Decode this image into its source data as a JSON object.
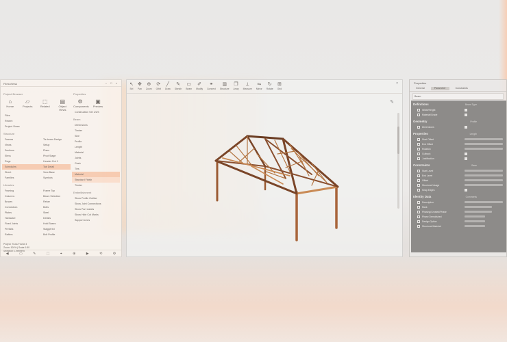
{
  "left_panel": {
    "title": "Files/Views",
    "controls": "– □ ×",
    "col_a": {
      "header": "Project Browser",
      "tiles": [
        {
          "icon": "home-icon",
          "label": "Home"
        },
        {
          "icon": "folder-icon",
          "label": "Projects"
        },
        {
          "icon": "model-icon",
          "label": "Related"
        },
        {
          "icon": "layers-icon",
          "label": "Object Views"
        }
      ],
      "sub": [
        "Files",
        "Recent",
        "Project Views"
      ],
      "section": "Structure",
      "rows": [
        [
          "Frames",
          "Tie beam Design"
        ],
        [
          "Views",
          "Setup"
        ],
        [
          "Sections",
          "Plans"
        ],
        [
          "Elevs",
          "Pivot Stage"
        ],
        [
          "Regs",
          "Header Out 1"
        ],
        [
          "Schedules",
          "Tab Detail"
        ],
        [
          "Sheet",
          "View Base"
        ],
        [
          "Families",
          "Symbols"
        ]
      ],
      "section2": "Libraries",
      "rows2": [
        [
          "Framing",
          "Frame Top"
        ],
        [
          "Columns",
          "Beam Selection"
        ],
        [
          "Braces",
          "Rebar"
        ],
        [
          "Connectors",
          "Bolts"
        ],
        [
          "Plates",
          "Steel"
        ],
        [
          "Hardware",
          "Details"
        ],
        [
          "Fixed Joints",
          "Hold Bases"
        ],
        [
          "Prefabs",
          "Staggered"
        ],
        [
          "Rafters",
          "Bolt Profile"
        ],
        [
          "Trusses",
          "Beam Grid"
        ]
      ],
      "footer": [
        "Project: Truss Frame 4",
        "Zoom: 100% | Scale 1:50",
        "Selection: 1 element"
      ]
    },
    "col_b": {
      "header": "Properties",
      "tiles": [
        {
          "icon": "gear-icon",
          "label": "Components"
        },
        {
          "icon": "tag-icon",
          "label": "Preview"
        }
      ],
      "line": "Construction Set 1/2/3",
      "section": "Beam",
      "items": [
        "Dimensions",
        "Timber",
        "Size",
        "Profile",
        "Length",
        "Material",
        "Joints",
        "Grain",
        "Ties"
      ],
      "section2": "Material",
      "selected_a": "Standard Finish",
      "selected_b": "Timber",
      "section3": "Embellishment",
      "checks": [
        "Show Profile Outline",
        "Show Joint Connections",
        "Show Part Labels",
        "Show Hide Cut Marks",
        "Support Lines"
      ]
    },
    "tools": [
      "◀",
      "▭",
      "✎",
      "⬚",
      "⌖",
      "⊕",
      "▶",
      "⟲",
      "⚙"
    ]
  },
  "viewport": {
    "ribbon": [
      {
        "icon": "cursor-icon",
        "label": "Sel"
      },
      {
        "icon": "pan-icon",
        "label": "Pan"
      },
      {
        "icon": "zoom-icon",
        "label": "Zoom"
      },
      {
        "icon": "orbit-icon",
        "label": "Orbit"
      },
      {
        "icon": "line-icon",
        "label": "Draw"
      },
      {
        "icon": "pencil-icon",
        "label": "Sketch"
      },
      {
        "icon": "beam-icon",
        "label": "Beam"
      },
      {
        "icon": "edit-icon",
        "label": "Modify"
      },
      {
        "icon": "link-icon",
        "label": "Connect"
      },
      {
        "icon": "wall-icon",
        "label": "Structure"
      },
      {
        "icon": "copy-icon",
        "label": "Array"
      },
      {
        "icon": "measure-icon",
        "label": "Measure"
      },
      {
        "icon": "mirror-icon",
        "label": "Mirror"
      },
      {
        "icon": "rotate-icon",
        "label": "Rotate"
      },
      {
        "icon": "grid-icon",
        "label": "Grid"
      }
    ],
    "close": "×",
    "colors": {
      "wood_light": "#c98a55",
      "wood_dark": "#7a4528",
      "wood_mid": "#a8643a"
    }
  },
  "right_panel": {
    "title": "Properties",
    "tabs": [
      "General",
      "Parameter",
      "Constraints"
    ],
    "search": "Beam",
    "sections": [
      {
        "title": "Definitions",
        "value": "Beam Type",
        "props": [
          {
            "name": "Width/Height",
            "kind": "check"
          },
          {
            "name": "Material/Grade",
            "kind": "check"
          }
        ]
      },
      {
        "title": "Geometry",
        "value": "Profile",
        "props": [
          {
            "name": "Dimensions",
            "kind": "check"
          }
        ]
      },
      {
        "title": "Properties",
        "value": "Length",
        "props": [
          {
            "name": "Start Offset",
            "kind": "bar"
          },
          {
            "name": "End Offset",
            "kind": "bar"
          },
          {
            "name": "Rotation",
            "kind": "bar"
          },
          {
            "name": "Cutback",
            "kind": "check"
          },
          {
            "name": "Justification",
            "kind": "check"
          }
        ]
      },
      {
        "title": "Constraints",
        "value": "Base",
        "props": [
          {
            "name": "Start Level",
            "kind": "bar"
          },
          {
            "name": "End Level",
            "kind": "bar"
          },
          {
            "name": "Offset",
            "kind": "bar"
          },
          {
            "name": "Structural Usage",
            "kind": "bar"
          },
          {
            "name": "Snap Edges",
            "kind": "check"
          }
        ]
      },
      {
        "title": "Identity Data",
        "value": "Comments",
        "props": [
          {
            "name": "Description",
            "kind": "bar"
          },
          {
            "name": "Mark",
            "kind": "bar2"
          },
          {
            "name": "Phasing/Created/Phase",
            "kind": "bar2"
          },
          {
            "name": "Phase Demolished",
            "kind": "bar3"
          },
          {
            "name": "Design Option",
            "kind": "bar3"
          },
          {
            "name": "Structural Material",
            "kind": "bar3"
          }
        ]
      }
    ]
  }
}
